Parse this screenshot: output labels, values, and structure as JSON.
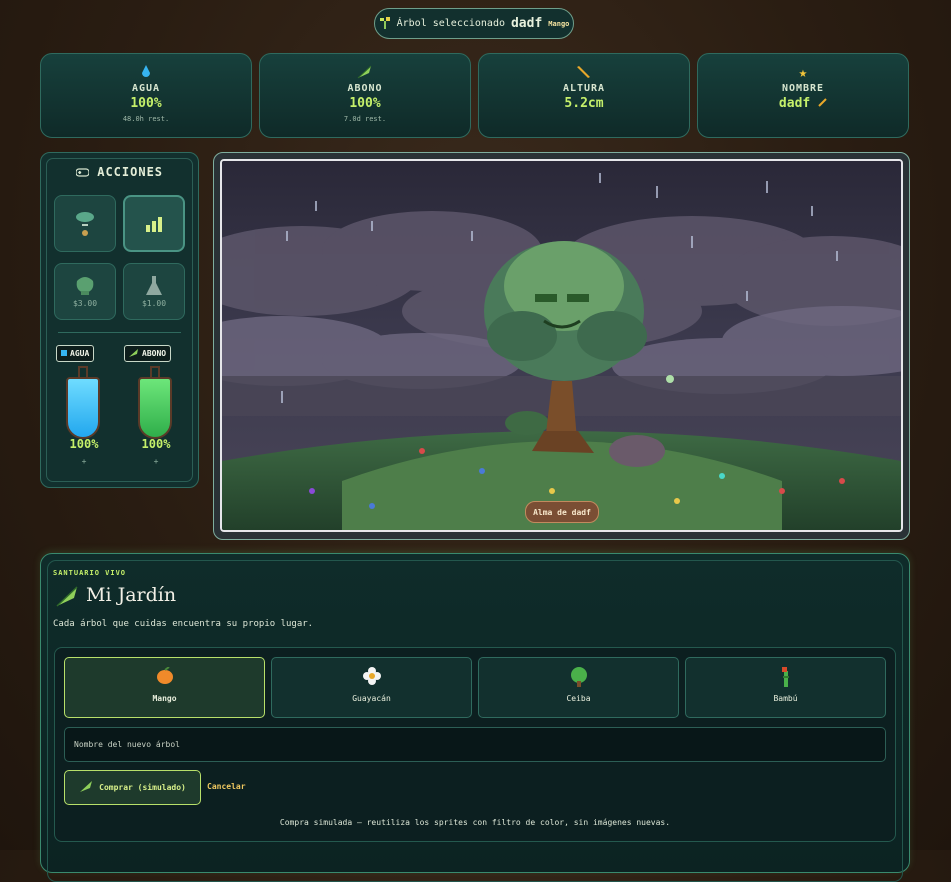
{
  "header": {
    "selected_label": "Árbol seleccionado",
    "tree_name": "dadf",
    "species_badge": "Mango"
  },
  "stats": [
    {
      "icon": "water-drop-icon",
      "label": "AGUA",
      "value": "100%",
      "sub": "48.0h rest."
    },
    {
      "icon": "leaf-icon",
      "label": "ABONO",
      "value": "100%",
      "sub": "7.0d rest."
    },
    {
      "icon": "ruler-icon",
      "label": "ALTURA",
      "value": "5.2cm",
      "sub": ""
    },
    {
      "icon": "star-icon",
      "label": "NOMBRE",
      "value": "dadf",
      "sub": ""
    }
  ],
  "actions": {
    "title": "ACCIONES",
    "buttons": [
      {
        "icon": "seed-icon",
        "label": ""
      },
      {
        "icon": "bars-chart-icon",
        "label": ""
      },
      {
        "icon": "fertilizer-icon",
        "label": "$3.00"
      },
      {
        "icon": "potion-flask-icon",
        "label": "$1.00"
      }
    ],
    "meters": [
      {
        "label": "AGUA",
        "value": "100%",
        "level": 1.0,
        "plus": "+"
      },
      {
        "label": "ABONO",
        "value": "100%",
        "level": 1.0,
        "plus": "+"
      }
    ]
  },
  "scene": {
    "soul_label": "Alma de dadf"
  },
  "garden": {
    "eyebrow": "SANTUARIO VIVO",
    "title": "Mi Jardín",
    "description": "Cada árbol que cuidas encuentra su propio lugar.",
    "trees": [
      {
        "label": "Mango",
        "icon": "mango-icon",
        "selected": true
      },
      {
        "label": "Guayacán",
        "icon": "flower-icon",
        "selected": false
      },
      {
        "label": "Ceiba",
        "icon": "tree-icon",
        "selected": false
      },
      {
        "label": "Bambú",
        "icon": "bamboo-icon",
        "selected": false
      }
    ],
    "name_placeholder": "Nombre del nuevo árbol",
    "buy_label": "Comprar (simulado)",
    "cancel_label": "Cancelar",
    "note": "Compra simulada — reutiliza los sprites con filtro de color, sin imágenes nuevas."
  },
  "colors": {
    "accent": "#c5f06a",
    "panel": "#12302e",
    "border": "#2f6a5e",
    "water": "#22a7ee",
    "fertilizer": "#2fae4a"
  }
}
